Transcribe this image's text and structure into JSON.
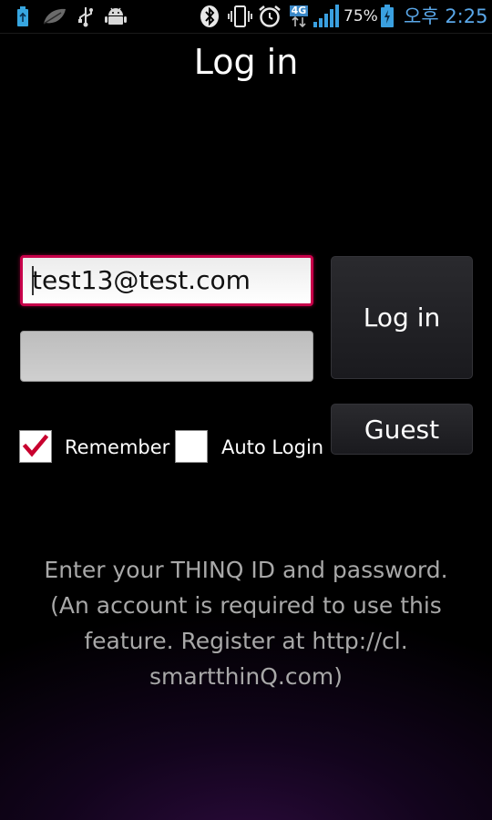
{
  "status_bar": {
    "network": "4G",
    "battery": "75%",
    "clock": "오후 2:25",
    "icons": [
      "usb-storage-icon",
      "leaf-icon",
      "usb-icon",
      "android-debug-icon",
      "bluetooth-icon",
      "vibrate-icon",
      "alarm-icon",
      "signal-icon",
      "battery-icon"
    ]
  },
  "header": {
    "title": "Log in"
  },
  "form": {
    "email_value": "test13@test.com",
    "password_value": "",
    "login_label": "Log in",
    "guest_label": "Guest",
    "remember_label": "Remember",
    "remember_checked": true,
    "autologin_label": "Auto Login",
    "autologin_checked": false
  },
  "info": {
    "lines": [
      "Enter your THINQ ID and password.",
      "(An account is required to use this",
      "feature. Register at http://cl.",
      "smartthinQ.com)"
    ]
  },
  "colors": {
    "accent": "#c8004a",
    "clock": "#5aa7e8",
    "battery": "#3aa0e0",
    "check": "#c8002e"
  }
}
